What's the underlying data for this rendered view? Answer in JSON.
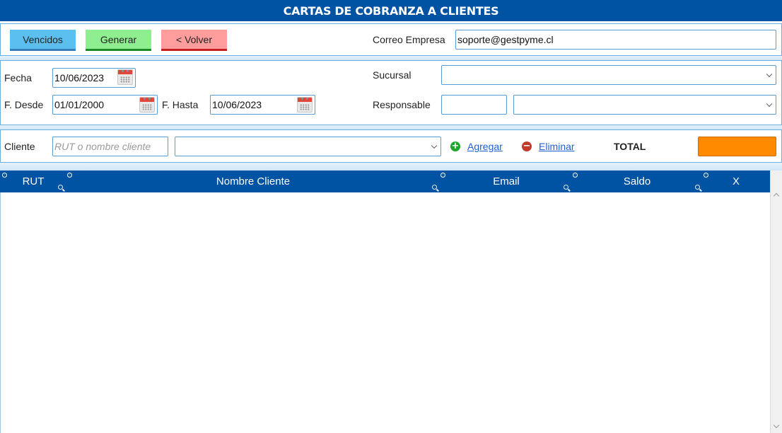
{
  "window": {
    "title": "CARTAS DE COBRANZA A CLIENTES"
  },
  "toolbar": {
    "vencidos_label": "Vencidos",
    "generar_label": "Generar",
    "volver_label": "< Volver",
    "correo_label": "Correo Empresa",
    "correo_value": "soporte@gestpyme.cl"
  },
  "filters": {
    "fecha_label": "Fecha",
    "fecha_value": "10/06/2023",
    "desde_label": "F. Desde",
    "desde_value": "01/01/2000",
    "hasta_label": "F. Hasta",
    "hasta_value": "10/06/2023",
    "sucursal_label": "Sucursal",
    "sucursal_value": "",
    "responsable_label": "Responsable",
    "responsable_code": "",
    "responsable_value": ""
  },
  "client": {
    "label": "Cliente",
    "placeholder": "RUT o nombre cliente",
    "select_value": "",
    "agregar_label": "Agregar",
    "eliminar_label": "Eliminar",
    "total_label": "TOTAL",
    "total_value": ""
  },
  "grid": {
    "columns": [
      "RUT",
      "Nombre Cliente",
      "Email",
      "Saldo",
      "X"
    ],
    "rows": []
  },
  "colors": {
    "header_blue": "#0052a3",
    "vencidos": "#5bc0f0",
    "generar": "#8fee8f",
    "volver": "#ff9d9d",
    "total": "#ff8a00"
  }
}
